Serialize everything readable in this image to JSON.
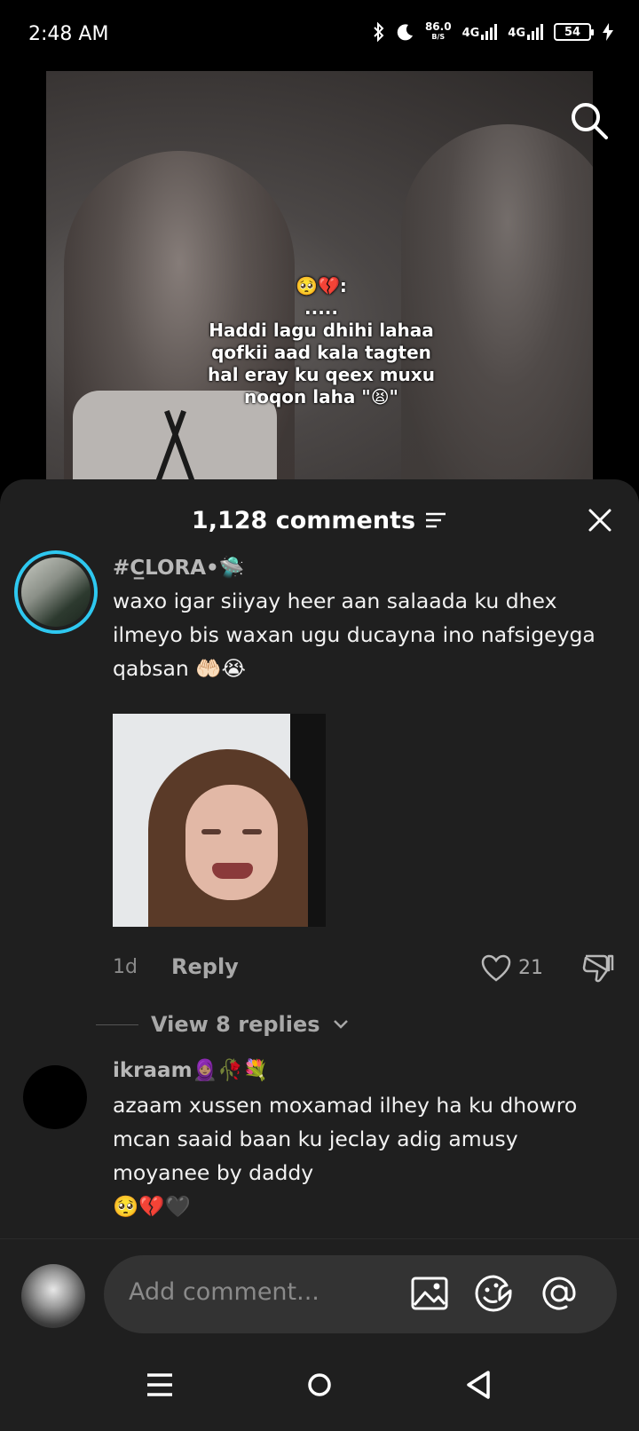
{
  "status": {
    "time": "2:48 AM",
    "net_speed": "86.0",
    "net_unit": "B/S",
    "sim1": "4G",
    "sim2": "4G",
    "battery": "54"
  },
  "video": {
    "caption": "🥺💔:\n.....\nHaddi lagu dhihi lahaa\nqofkii aad kala tagten\nhal eray ku qeex muxu\nnoqon laha \"😫\""
  },
  "comments_header": {
    "count_label": "1,128 comments"
  },
  "comments": [
    {
      "username": "#C̲LORA•🛸",
      "text": "waxo igar siiyay heer aan salaada ku dhex ilmeyo bis waxan ugu ducayna ino nafsigeyga qabsan 🤲🏻😭",
      "age": "1d",
      "reply_label": "Reply",
      "likes": "21",
      "view_replies": "View 8 replies"
    },
    {
      "username": "ikraam🧕🏽🥀💐",
      "text": "azaam xussen moxamad ilhey ha ku dhowro mcan saaid baan ku jeclay adig amusy moyanee by daddy\n🥺💔🖤"
    }
  ],
  "input": {
    "placeholder": "Add comment..."
  },
  "icons": {
    "search": "search-icon",
    "filter": "filter-icon",
    "close": "close-icon",
    "like": "heart-icon",
    "dislike": "thumbs-down-icon",
    "image": "image-icon",
    "sticker": "sticker-icon",
    "mention": "at-icon"
  },
  "colors": {
    "sheet_bg": "#1f1f1f",
    "avatar_ring": "#2ec8f0"
  }
}
